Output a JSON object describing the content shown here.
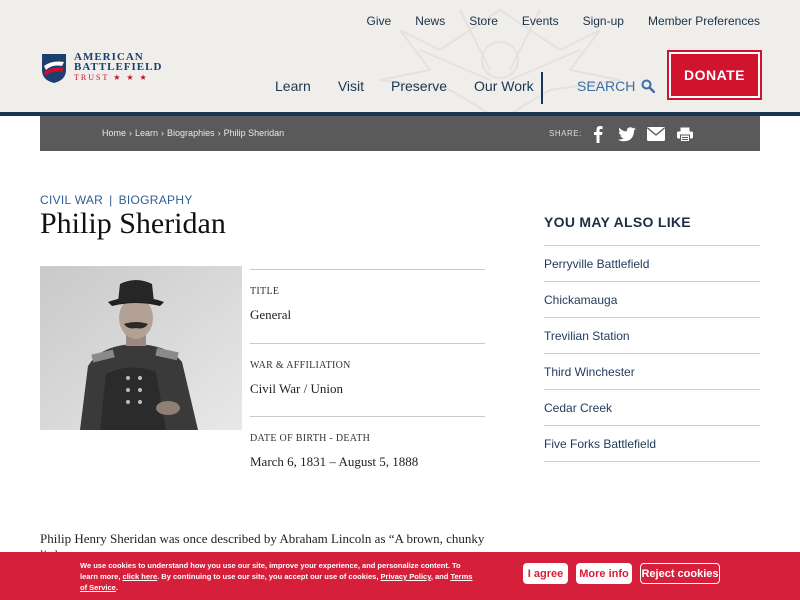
{
  "header": {
    "top_links": [
      "Give",
      "News",
      "Store",
      "Events",
      "Sign-up",
      "Member Preferences"
    ],
    "logo": {
      "line1": "AMERICAN",
      "line2": "BATTLEFIELD",
      "line3": "TRUST ★ ★ ★"
    },
    "nav": [
      "Learn",
      "Visit",
      "Preserve",
      "Our Work"
    ],
    "search_label": "SEARCH",
    "donate_label": "DONATE"
  },
  "breadcrumb": {
    "items": [
      "Home",
      "Learn",
      "Biographies",
      "Philip Sheridan"
    ],
    "share_label": "SHARE:",
    "share_icons": [
      "facebook-icon",
      "twitter-icon",
      "email-icon",
      "print-icon"
    ]
  },
  "article": {
    "categories": [
      "CIVIL WAR",
      "BIOGRAPHY"
    ],
    "separator": "|",
    "title": "Philip Sheridan",
    "facts": [
      {
        "label": "Title",
        "value": "General"
      },
      {
        "label": "War & Affiliation",
        "value": "Civil War / Union"
      },
      {
        "label": "Date of Birth - Death",
        "value": "March 6, 1831 – August 5, 1888"
      }
    ],
    "intro": "Philip Henry Sheridan was once described by Abraham Lincoln as “A brown, chunky little"
  },
  "sidebar": {
    "title": "YOU MAY ALSO LIKE",
    "items": [
      "Perryville Battlefield",
      "Chickamauga",
      "Trevilian Station",
      "Third Winchester",
      "Cedar Creek",
      "Five Forks Battlefield"
    ]
  },
  "cookie": {
    "text_part1": "We use cookies to understand how you use our site, improve your experience, and personalize content. To learn more,",
    "link1": "click here",
    "text_part2": ". By continuing to use our site, you accept our use of cookies,",
    "link2": "Privacy Policy",
    "text_part3": ", and",
    "link3": "Terms of Service",
    "text_part4": ".",
    "agree_label": "I agree",
    "more_label": "More info",
    "reject_label": "Reject cookies"
  },
  "colors": {
    "brand_red": "#d1142e",
    "brand_navy": "#1a3552",
    "link_blue": "#2f5f96"
  }
}
